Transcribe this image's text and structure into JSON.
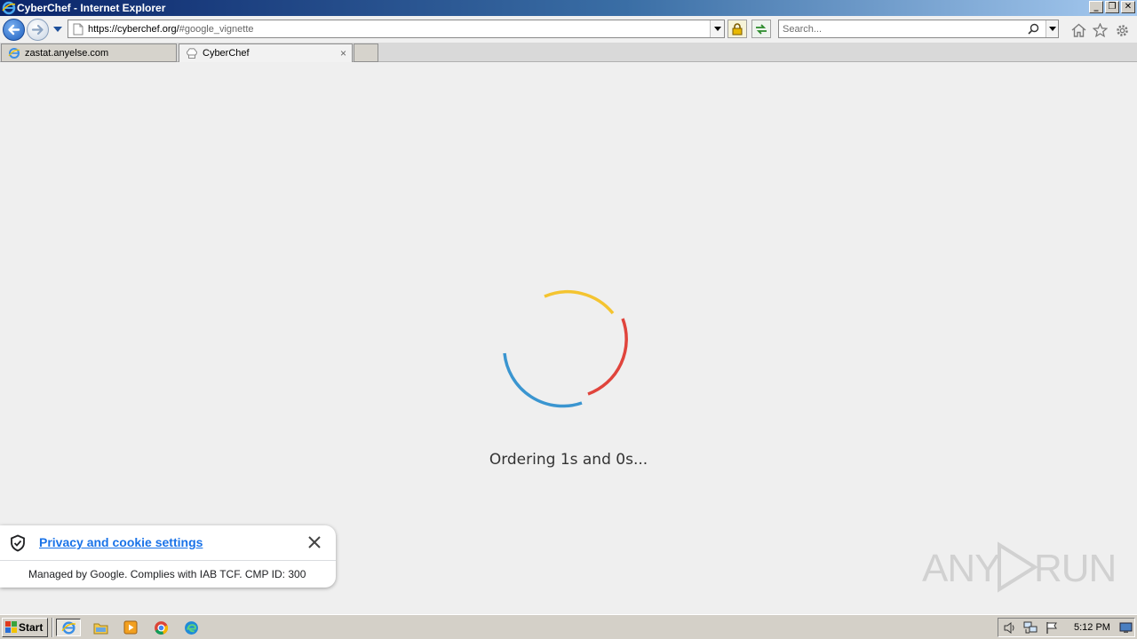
{
  "window": {
    "title": "CyberChef - Internet Explorer"
  },
  "navbar": {
    "url_main": "https://cyberchef.org/",
    "url_fragment": "#google_vignette",
    "search_placeholder": "Search..."
  },
  "tabs": [
    {
      "label": "zastat.anyelse.com",
      "active": false
    },
    {
      "label": "CyberChef",
      "active": true,
      "close": "×"
    }
  ],
  "content": {
    "loading_text": "Ordering 1s and 0s...",
    "spinner_colors": {
      "yellow": "#f4c430",
      "red": "#e0443c",
      "blue": "#3a95d0"
    }
  },
  "privacy_banner": {
    "link_label": "Privacy and cookie settings",
    "managed_text": "Managed by Google. Complies with IAB TCF. CMP ID: 300"
  },
  "watermark": {
    "text_left": "ANY",
    "text_right": "RUN"
  },
  "taskbar": {
    "start_label": "Start",
    "clock": "5:12 PM"
  }
}
